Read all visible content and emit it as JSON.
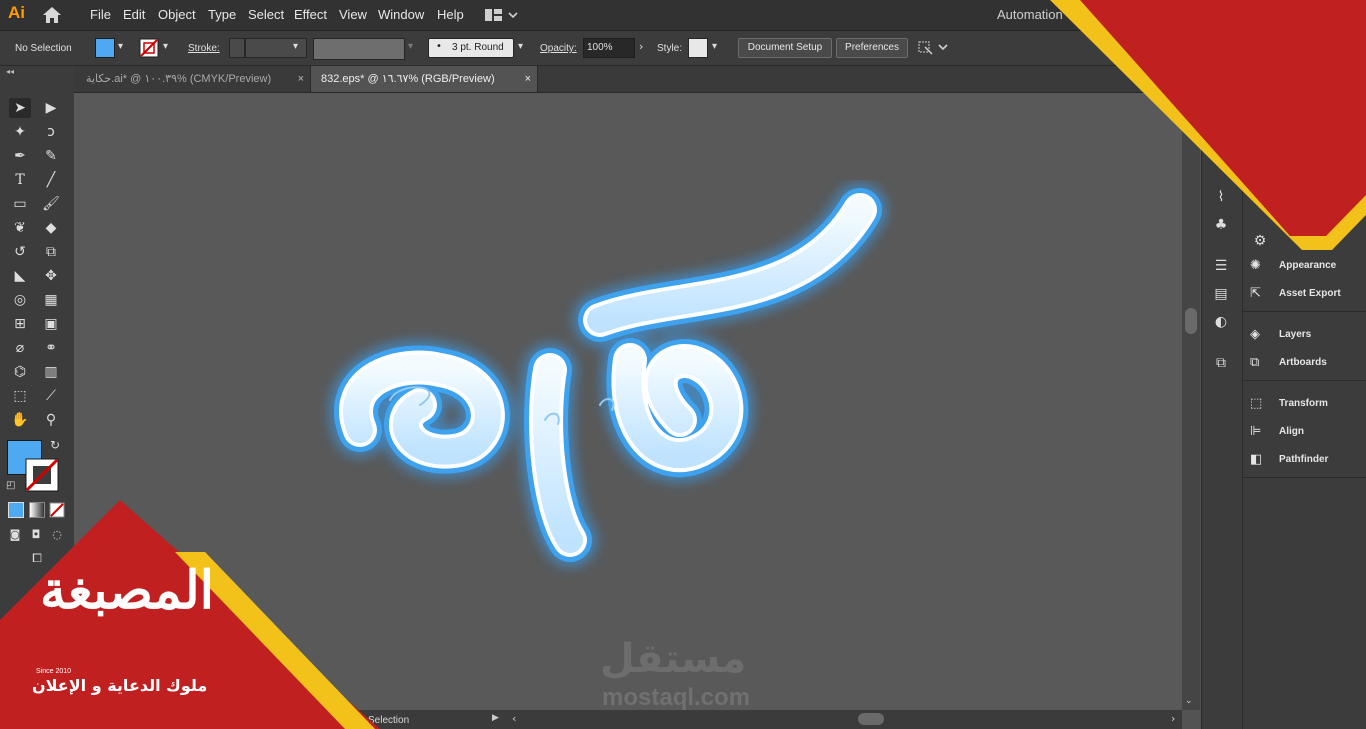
{
  "app": {
    "logo": "Ai",
    "workspace": "Automation"
  },
  "menu": [
    "File",
    "Edit",
    "Object",
    "Type",
    "Select",
    "Effect",
    "View",
    "Window",
    "Help"
  ],
  "control": {
    "selection": "No Selection",
    "stroke_label": "Stroke:",
    "brush": "3 pt. Round",
    "opacity_label": "Opacity:",
    "opacity_value": "100%",
    "style_label": "Style:",
    "doc_setup": "Document Setup",
    "preferences": "Preferences",
    "fill_color": "#4fa8f2"
  },
  "tabs": [
    {
      "label": "حكاية.ai* @ ١٠٠.٣٩% (CMYK/Preview)",
      "active": false
    },
    {
      "label": "832.eps* @ ١٦.٦٧% (RGB/Preview)",
      "active": true
    }
  ],
  "panels": {
    "group1": [
      "Appearance",
      "Asset Export"
    ],
    "group2": [
      "Layers",
      "Artboards"
    ],
    "group3": [
      "Transform",
      "Align",
      "Pathfinder"
    ]
  },
  "status": {
    "tool": "Selection"
  },
  "canvas": {
    "watermark_arabic": "مستقل",
    "watermark_latin": "mostaql.com"
  },
  "brand": {
    "name": "المصبغة",
    "since": "Since 2010",
    "tagline": "ملوك الدعاية و الإعلان",
    "red": "#c0201f",
    "yellow": "#f2c21b"
  }
}
